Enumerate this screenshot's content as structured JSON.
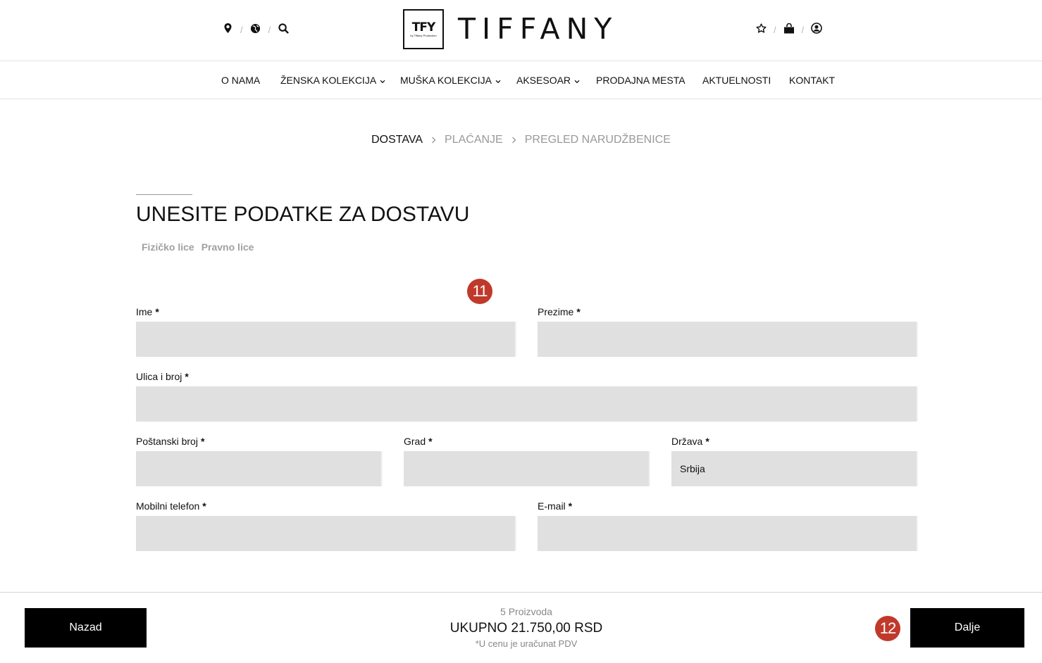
{
  "header": {
    "brand_word": "TIFFANY",
    "brand_mark": "TFY",
    "brand_tag": "by Tiffany Production",
    "left_icons": [
      "location-icon",
      "globe-icon",
      "search-icon"
    ],
    "right_icons": [
      "star-icon",
      "bag-icon",
      "user-icon"
    ],
    "separator": "/"
  },
  "nav": {
    "items": [
      {
        "label": "O NAMA"
      },
      {
        "label": "ŽENSKA KOLEKCIJA"
      },
      {
        "label": "MUŠKA KOLEKCIJA"
      },
      {
        "label": "AKSESOAR"
      },
      {
        "label": "PRODAJNA MESTA"
      },
      {
        "label": "AKTUELNOSTI"
      },
      {
        "label": "KONTAKT"
      }
    ]
  },
  "steps": [
    {
      "label": "DOSTAVA",
      "active": true
    },
    {
      "label": "PLAĆANJE",
      "active": false
    },
    {
      "label": "PREGLED NARUDŽBENICE",
      "active": false
    }
  ],
  "form": {
    "title": "UNESITE PODATKE ZA DOSTAVU",
    "tabs": [
      "Fizičko lice",
      "Pravno lice"
    ],
    "required_mark": "*",
    "fields": {
      "first_name": {
        "label": "Ime",
        "value": ""
      },
      "last_name": {
        "label": "Prezime",
        "value": ""
      },
      "street": {
        "label": "Ulica i broj",
        "value": ""
      },
      "postal": {
        "label": "Poštanski broj",
        "value": ""
      },
      "city": {
        "label": "Grad",
        "value": ""
      },
      "country": {
        "label": "Država",
        "value": "Srbija"
      },
      "phone": {
        "label": "Mobilni telefon",
        "value": ""
      },
      "email": {
        "label": "E-mail",
        "value": ""
      }
    }
  },
  "annotations": {
    "badge_a": "11",
    "badge_b": "12",
    "color": "#c0392b"
  },
  "footer": {
    "back_label": "Nazad",
    "next_label": "Dalje",
    "count": "5 Proizvoda",
    "total": "UKUPNO 21.750,00 RSD",
    "vat_note": "*U cenu je uračunat PDV"
  }
}
